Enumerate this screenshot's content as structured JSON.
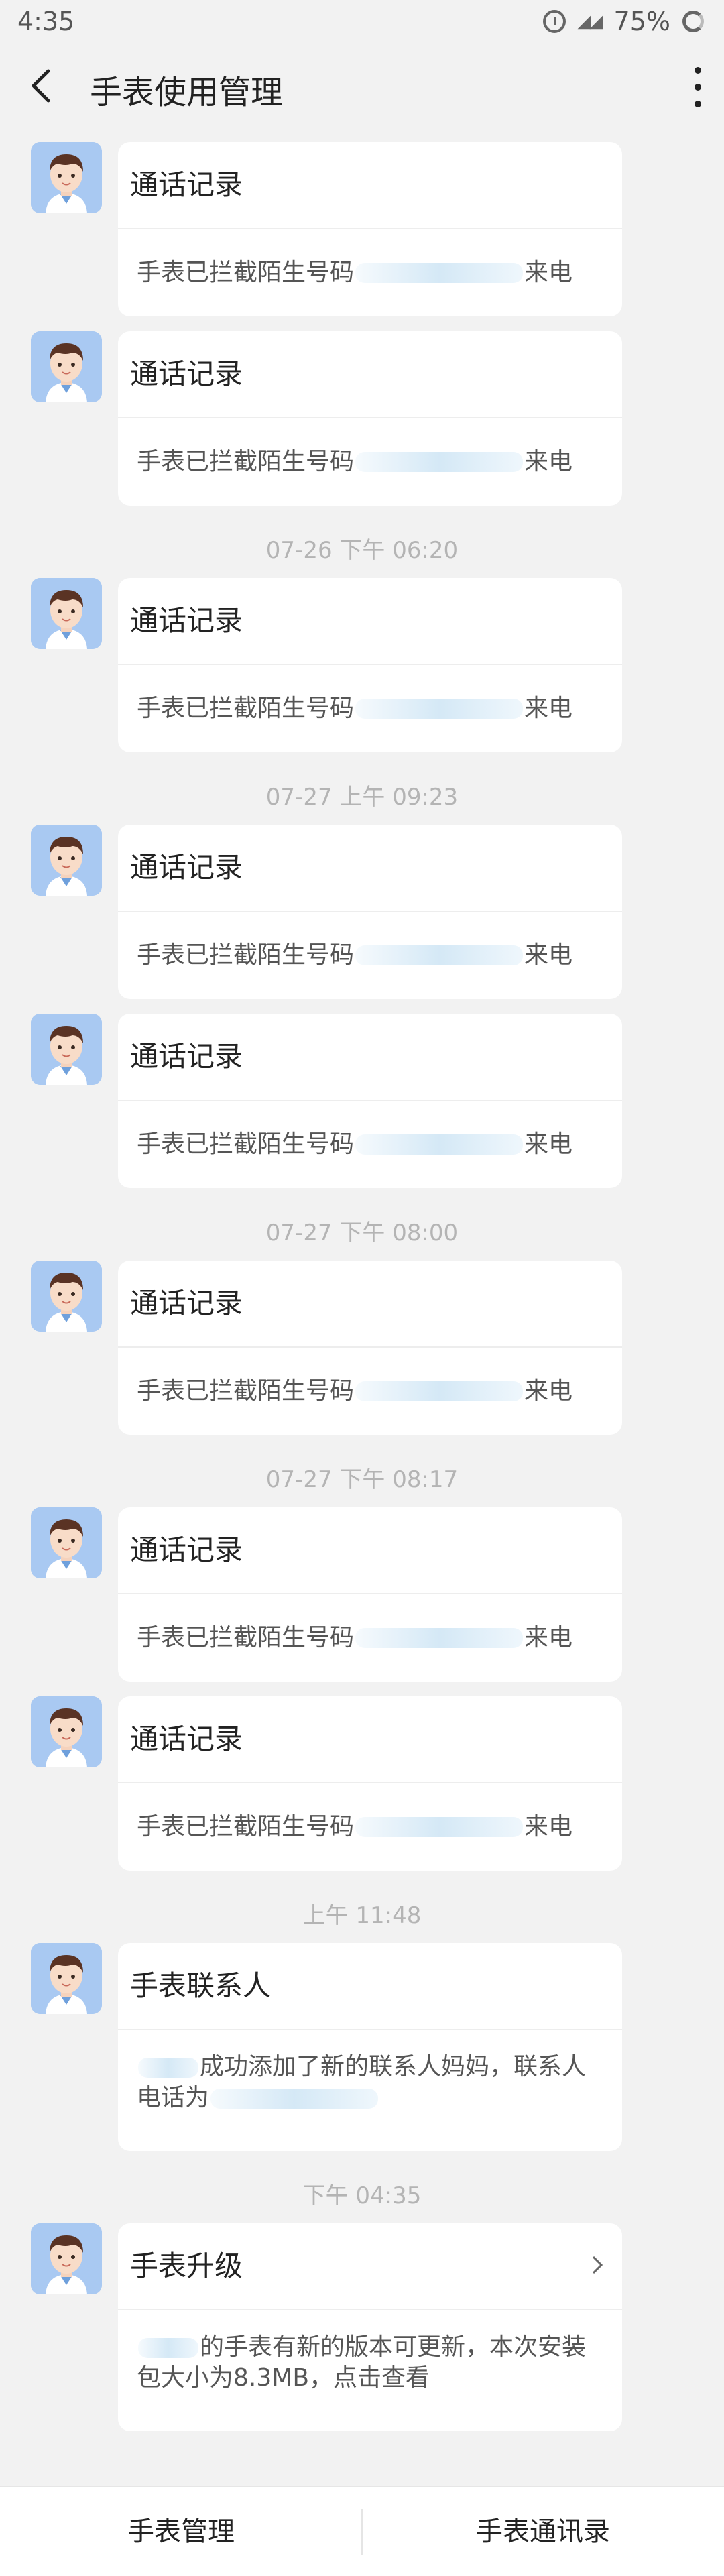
{
  "status": {
    "time": "4:35",
    "battery": "75%"
  },
  "header": {
    "title": "手表使用管理"
  },
  "feed": [
    {
      "type": "message",
      "title": "通话记录",
      "text_before": "手表已拦截陌生号码",
      "text_after": "来电"
    },
    {
      "type": "message",
      "title": "通话记录",
      "text_before": "手表已拦截陌生号码",
      "text_after": "来电"
    },
    {
      "type": "timestamp",
      "text": "07-26 下午 06:20"
    },
    {
      "type": "message",
      "title": "通话记录",
      "text_before": "手表已拦截陌生号码",
      "text_after": "来电"
    },
    {
      "type": "timestamp",
      "text": "07-27 上午 09:23"
    },
    {
      "type": "message",
      "title": "通话记录",
      "text_before": "手表已拦截陌生号码",
      "text_after": "来电"
    },
    {
      "type": "message",
      "title": "通话记录",
      "text_before": "手表已拦截陌生号码",
      "text_after": "来电"
    },
    {
      "type": "timestamp",
      "text": "07-27 下午 08:00"
    },
    {
      "type": "message",
      "title": "通话记录",
      "text_before": "手表已拦截陌生号码",
      "text_after": "来电"
    },
    {
      "type": "timestamp",
      "text": "07-27 下午 08:17"
    },
    {
      "type": "message",
      "title": "通话记录",
      "text_before": "手表已拦截陌生号码",
      "text_after": "来电"
    },
    {
      "type": "message",
      "title": "通话记录",
      "text_before": "手表已拦截陌生号码",
      "text_after": "来电"
    },
    {
      "type": "timestamp",
      "text": "上午 11:48"
    },
    {
      "type": "message",
      "title": "手表联系人",
      "line1": "成功添加了新的联系人妈妈，联系人",
      "line2": "电话为"
    },
    {
      "type": "timestamp",
      "text": "下午 04:35"
    },
    {
      "type": "message",
      "title": "手表升级",
      "line1": "的手表有新的版本可更新，本次安装",
      "line2": "包大小为8.3MB，点击查看",
      "chevron": true
    }
  ],
  "bottom_nav": {
    "left": "手表管理",
    "right": "手表通讯录"
  }
}
